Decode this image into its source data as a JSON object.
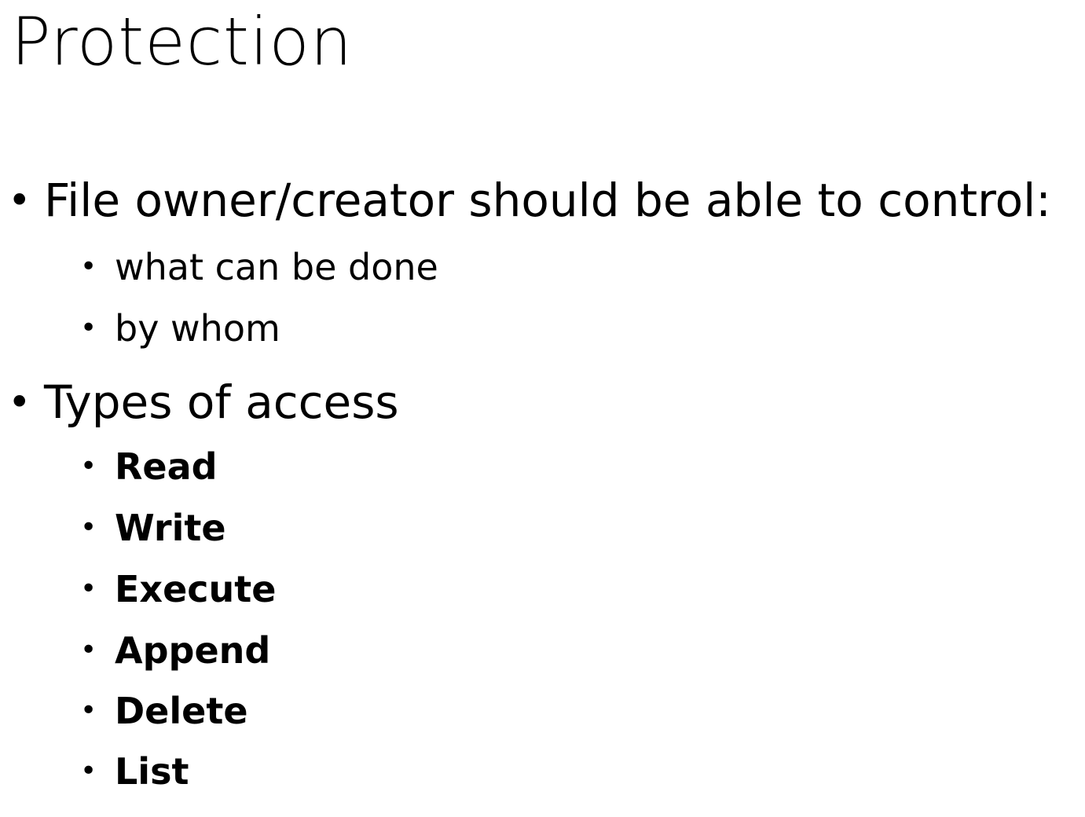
{
  "slide": {
    "title": "Protection",
    "bullets": [
      {
        "text": "File owner/creator should be able to control:",
        "children": [
          "what can be done",
          "by whom"
        ]
      },
      {
        "text": "Types of access",
        "children": [
          "Read",
          "Write",
          "Execute",
          "Append",
          "Delete",
          "List"
        ]
      }
    ]
  }
}
